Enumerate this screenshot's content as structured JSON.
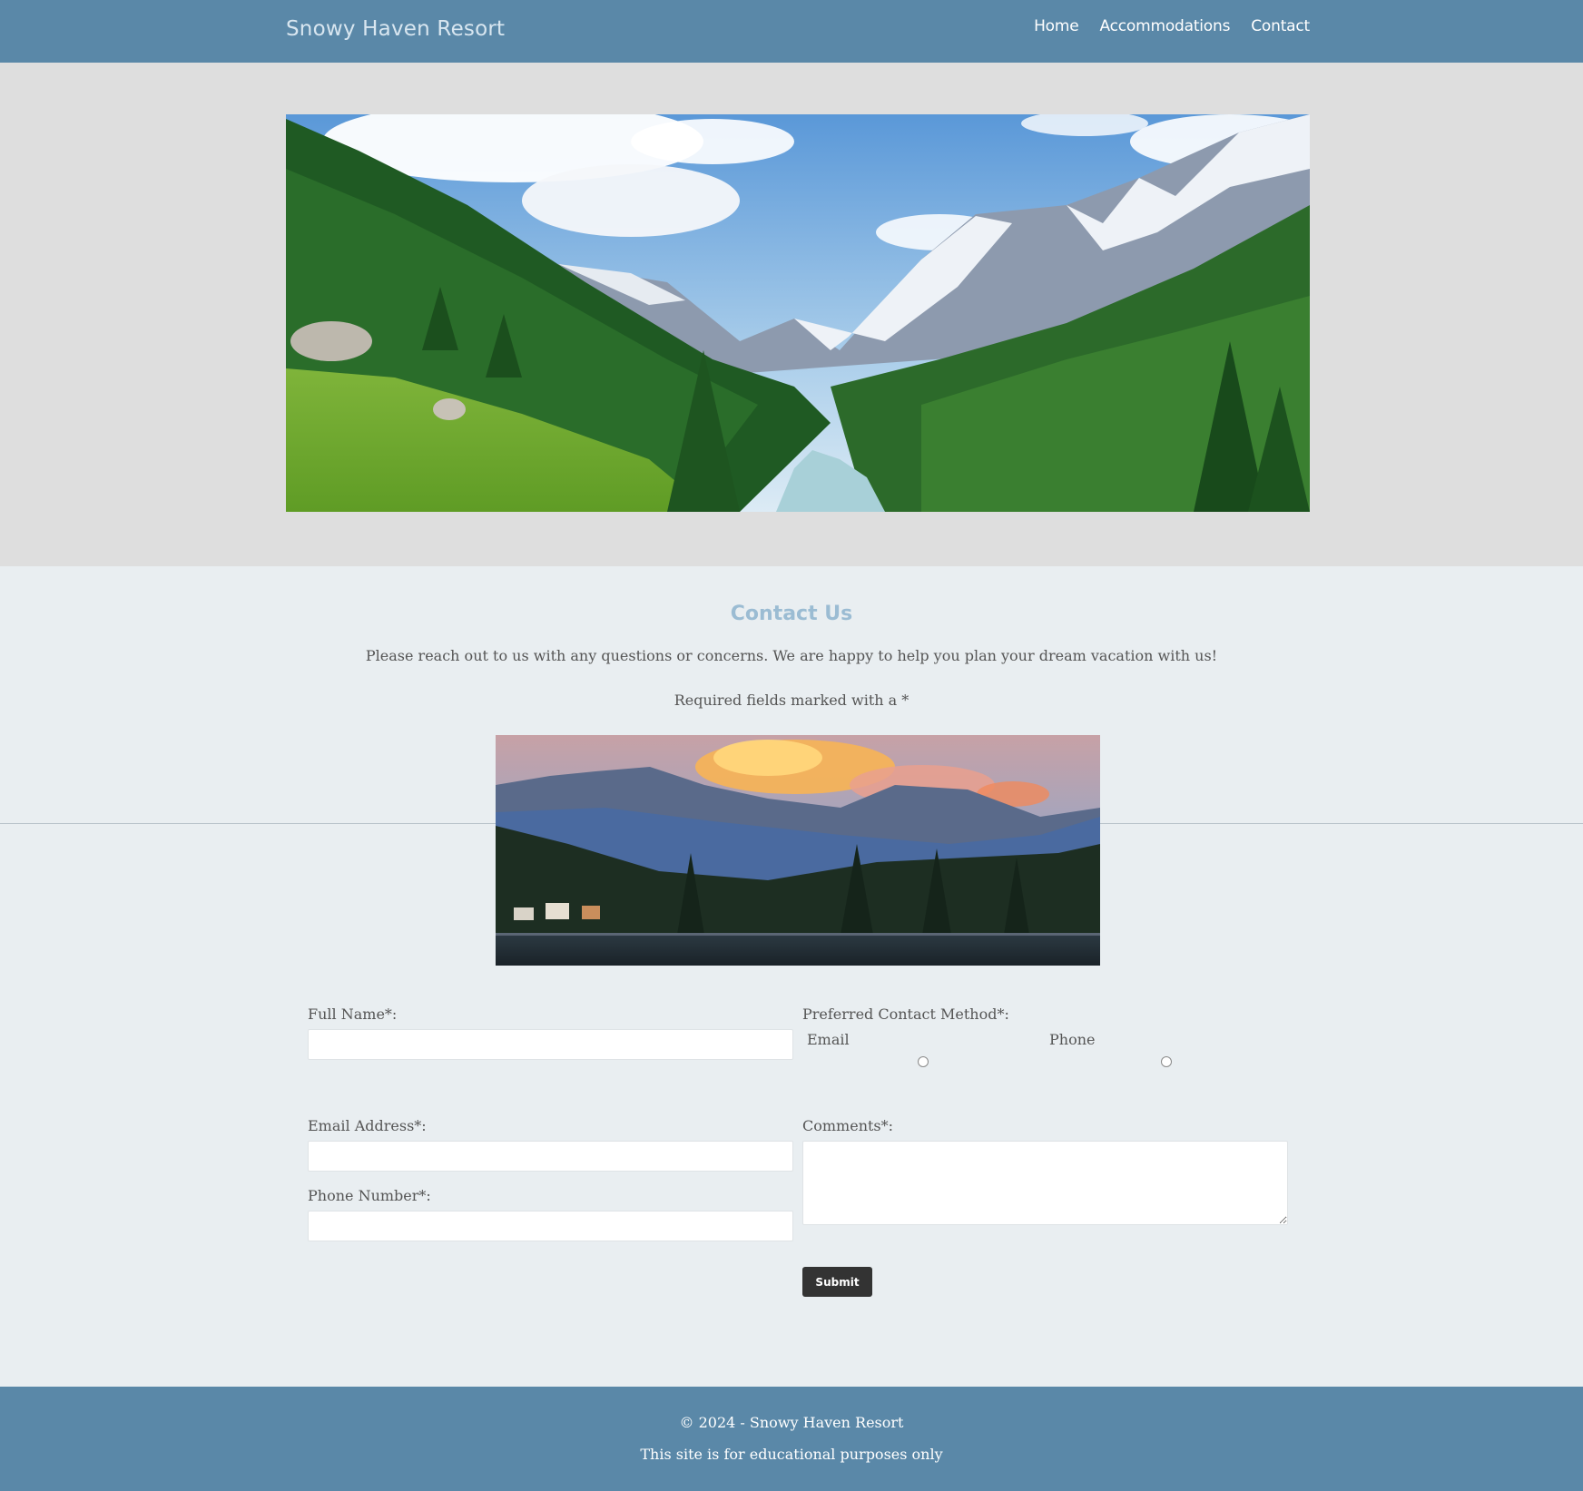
{
  "header": {
    "brand": "Snowy Haven Resort",
    "nav": [
      "Home",
      "Accommodations",
      "Contact"
    ]
  },
  "contact": {
    "title": "Contact Us",
    "intro": "Please reach out to us with any questions or concerns. We are happy to help you plan your dream vacation with us!",
    "required_note": "Required fields marked with a *"
  },
  "form": {
    "full_name_label": "Full Name*:",
    "full_name_value": "",
    "email_label": "Email Address*:",
    "email_value": "",
    "phone_label": "Phone Number*:",
    "phone_value": "",
    "contact_method_label": "Preferred Contact Method*:",
    "contact_method_options": [
      "Email",
      "Phone"
    ],
    "comments_label": "Comments*:",
    "comments_value": "",
    "submit_label": "Submit"
  },
  "footer": {
    "copyright": "© 2024 - Snowy Haven Resort",
    "note": "This site is for educational purposes only"
  },
  "colors": {
    "header_bg": "#5a88a8",
    "hero_bg": "#dedede",
    "section_bg": "#e9eef1",
    "title_accent": "#9bbcd3",
    "button_bg": "#333333"
  }
}
